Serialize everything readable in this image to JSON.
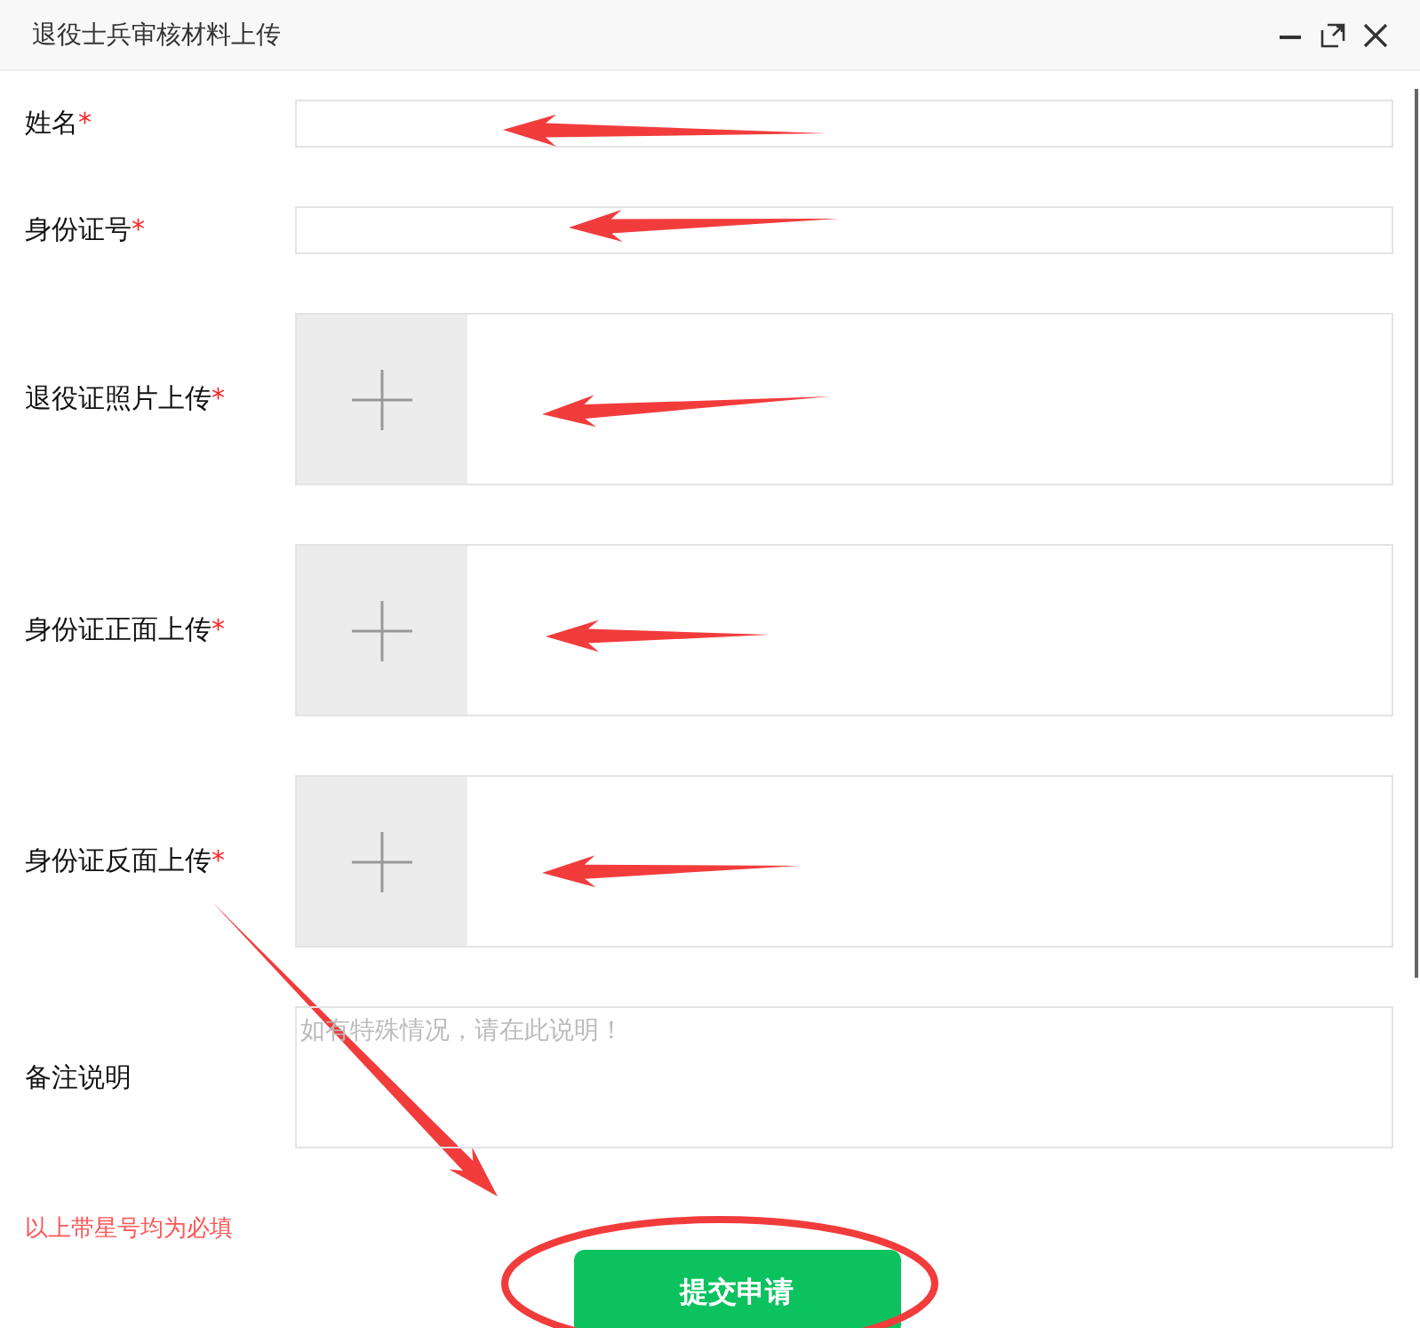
{
  "window": {
    "title": "退役士兵审核材料上传"
  },
  "fields": [
    {
      "kind": "text",
      "label": "姓名",
      "required_mark": "*"
    },
    {
      "kind": "text",
      "label": "身份证号",
      "required_mark": "*"
    },
    {
      "kind": "upload",
      "label": "退役证照片上传",
      "required_mark": "*"
    },
    {
      "kind": "upload",
      "label": "身份证正面上传",
      "required_mark": "*"
    },
    {
      "kind": "upload",
      "label": "身份证反面上传",
      "required_mark": "*"
    },
    {
      "kind": "textarea",
      "label": "备注说明",
      "placeholder": "如有特殊情况，请在此说明！"
    }
  ],
  "note": "以上带星号均为必填",
  "submit_button": "提交申请"
}
